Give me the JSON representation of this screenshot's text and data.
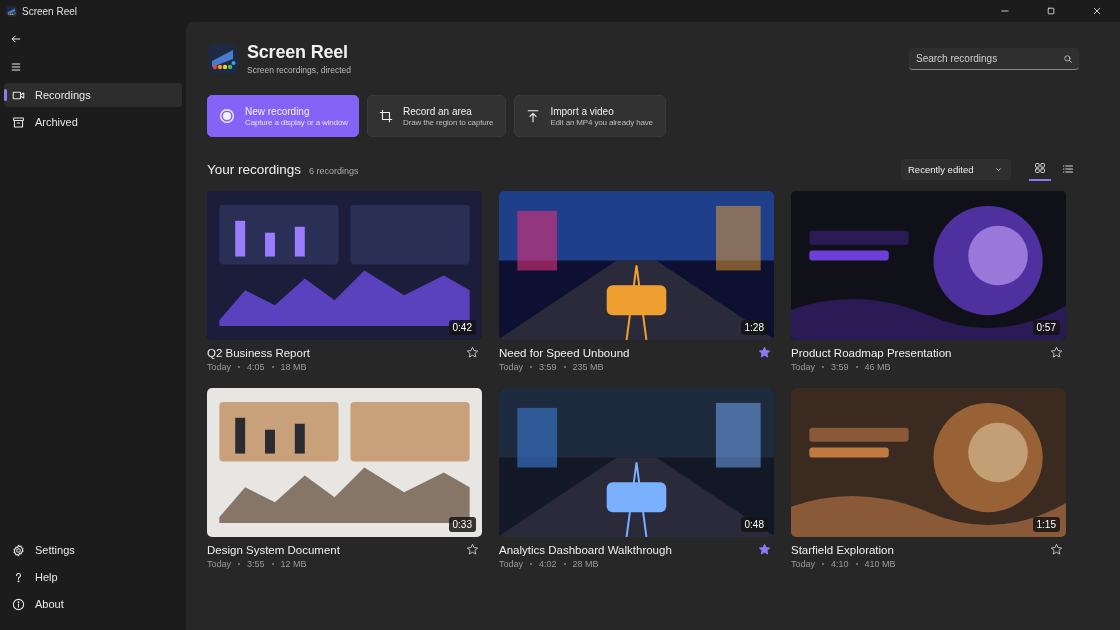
{
  "window": {
    "title": "Screen Reel"
  },
  "sidebar": {
    "items": [
      {
        "label": "Recordings",
        "selected": true
      },
      {
        "label": "Archived",
        "selected": false
      }
    ],
    "footer_items": [
      {
        "label": "Settings"
      },
      {
        "label": "Help"
      },
      {
        "label": "About"
      }
    ]
  },
  "header": {
    "title": "Screen Reel",
    "subtitle": "Screen recordings, directed"
  },
  "search": {
    "placeholder": "Search recordings"
  },
  "actions": [
    {
      "title": "New recording",
      "subtitle": "Capture a display or a window",
      "primary": true
    },
    {
      "title": "Record an area",
      "subtitle": "Draw the region to capture",
      "primary": false
    },
    {
      "title": "Import a video",
      "subtitle": "Edit an MP4 you already have",
      "primary": false
    }
  ],
  "section": {
    "title": "Your recordings",
    "count": "6 recordings"
  },
  "sort": {
    "value": "Recently edited"
  },
  "views": [
    {
      "selected": true
    },
    {
      "selected": false
    }
  ],
  "recordings": [
    {
      "title": "Q2 Business Report",
      "date": "Today",
      "time": "4:05",
      "size": "18 MB",
      "duration": "0:42",
      "favorite": false
    },
    {
      "title": "Need for Speed Unbound",
      "date": "Today",
      "time": "3:59",
      "size": "235 MB",
      "duration": "1:28",
      "favorite": true
    },
    {
      "title": "Product Roadmap Presentation",
      "date": "Today",
      "time": "3:59",
      "size": "46 MB",
      "duration": "0:57",
      "favorite": false
    },
    {
      "title": "Design System Document",
      "date": "Today",
      "time": "3:55",
      "size": "12 MB",
      "duration": "0:33",
      "favorite": false
    },
    {
      "title": "Analytics Dashboard Walkthrough",
      "date": "Today",
      "time": "4:02",
      "size": "28 MB",
      "duration": "0:48",
      "favorite": true
    },
    {
      "title": "Starfield Exploration",
      "date": "Today",
      "time": "4:10",
      "size": "410 MB",
      "duration": "1:15",
      "favorite": false
    }
  ]
}
